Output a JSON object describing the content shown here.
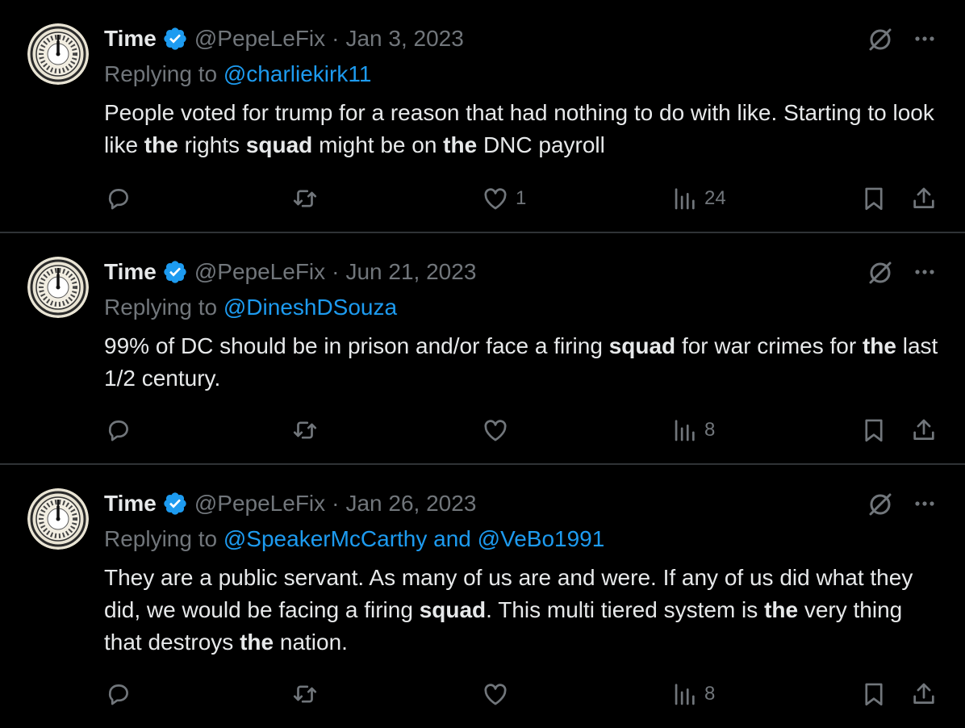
{
  "colors": {
    "background": "#000000",
    "text": "#e7e9ea",
    "muted": "#71767b",
    "link": "#1d9bf0",
    "divider": "#2f3336"
  },
  "icons": [
    "clock-avatar",
    "verified-badge-icon",
    "grok-icon",
    "more-icon",
    "reply-icon",
    "retweet-icon",
    "like-icon",
    "views-icon",
    "bookmark-icon",
    "share-icon"
  ],
  "tweets": [
    {
      "name": "Time",
      "handle": "@PepeLeFix",
      "separator": "·",
      "date": "Jan 3, 2023",
      "replying_prefix": "Replying to ",
      "replying_to": "@charliekirk11",
      "text_parts": [
        {
          "t": "People voted for trump for a reason that had nothing to do with like. Starting to look like ",
          "b": false
        },
        {
          "t": "the",
          "b": true
        },
        {
          "t": " rights ",
          "b": false
        },
        {
          "t": "squad",
          "b": true
        },
        {
          "t": " might be on ",
          "b": false
        },
        {
          "t": "the",
          "b": true
        },
        {
          "t": " DNC payroll",
          "b": false
        }
      ],
      "likes": "1",
      "views": "24"
    },
    {
      "name": "Time",
      "handle": "@PepeLeFix",
      "separator": "·",
      "date": "Jun 21, 2023",
      "replying_prefix": "Replying to ",
      "replying_to": "@DineshDSouza",
      "text_parts": [
        {
          "t": "99% of DC should be in prison and/or face a firing ",
          "b": false
        },
        {
          "t": "squad",
          "b": true
        },
        {
          "t": " for war crimes for ",
          "b": false
        },
        {
          "t": "the",
          "b": true
        },
        {
          "t": " last 1/2 century.",
          "b": false
        }
      ],
      "likes": "",
      "views": "8"
    },
    {
      "name": "Time",
      "handle": "@PepeLeFix",
      "separator": "·",
      "date": "Jan 26, 2023",
      "replying_prefix": "Replying to ",
      "replying_to": "@SpeakerMcCarthy and @VeBo1991",
      "text_parts": [
        {
          "t": "They are a public servant. As many of us are and were. If any of us did what they did, we would be facing a firing ",
          "b": false
        },
        {
          "t": "squad",
          "b": true
        },
        {
          "t": ". This multi tiered system is ",
          "b": false
        },
        {
          "t": "the",
          "b": true
        },
        {
          "t": " very thing that destroys ",
          "b": false
        },
        {
          "t": "the",
          "b": true
        },
        {
          "t": " nation.",
          "b": false
        }
      ],
      "likes": "",
      "views": "8"
    }
  ]
}
